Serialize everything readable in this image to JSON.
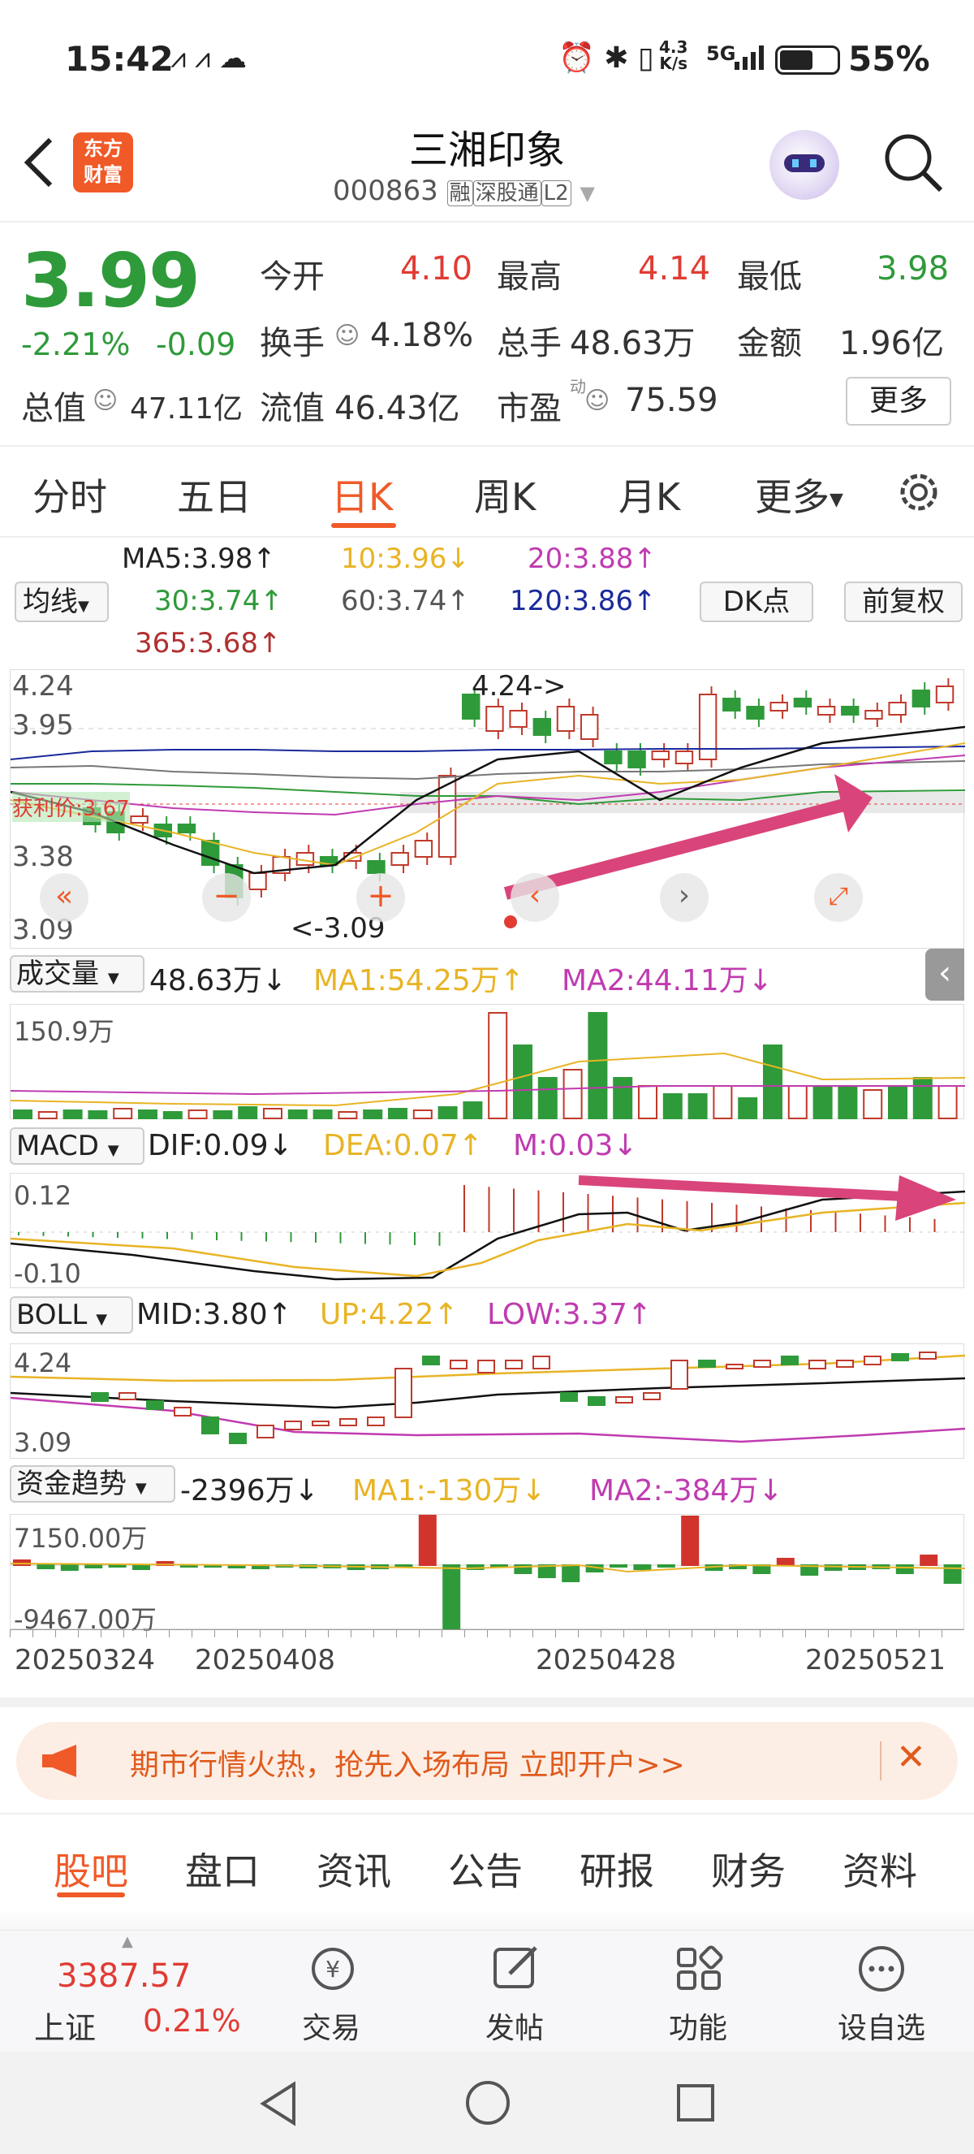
{
  "status_bar": {
    "time": "15:42",
    "net_speed_top": "4.3",
    "net_speed_bottom": "K/s",
    "network": "5G",
    "battery": "55%"
  },
  "header": {
    "app_logo_line1": "东方",
    "app_logo_line2": "财富",
    "title": "三湘印象",
    "code": "000863",
    "tags": [
      "融",
      "深股通",
      "L2"
    ]
  },
  "quote": {
    "price": "3.99",
    "change_pct": "-2.21%",
    "change": "-0.09",
    "open_label": "今开",
    "open": "4.10",
    "high_label": "最高",
    "high": "4.14",
    "low_label": "最低",
    "low": "3.98",
    "turnover_label": "换手",
    "turnover": "4.18%",
    "volume_label": "总手",
    "volume": "48.63万",
    "amount_label": "金额",
    "amount": "1.96亿",
    "mktcap_label": "总值",
    "mktcap": "47.11亿",
    "float_label": "流值",
    "float_cap": "46.43亿",
    "pe_label": "市盈",
    "pe_sup": "动",
    "pe": "75.59",
    "more": "更多"
  },
  "tabs": [
    "分时",
    "五日",
    "日K",
    "周K",
    "月K",
    "更多"
  ],
  "active_tab": "日K",
  "ma": {
    "selector": "均线",
    "ma5": "MA5:3.98↑",
    "ma10": "10:3.96↓",
    "ma20": "20:3.88↑",
    "ma30": "30:3.74↑",
    "ma60": "60:3.74↑",
    "ma120": "120:3.86↑",
    "ma365": "365:3.68↑",
    "dk": "DK点",
    "adjust": "前复权"
  },
  "kline": {
    "y_labels": [
      "4.24",
      "3.95",
      "3.38",
      "3.09"
    ],
    "max_mark": "4.24->",
    "min_mark": "<-3.09",
    "cost_label": "获利价:3.67"
  },
  "volume": {
    "selector": "成交量",
    "value": "48.63万↓",
    "ma1": "MA1:54.25万↑",
    "ma2": "MA2:44.11万↓",
    "y_label": "150.9万"
  },
  "macd": {
    "selector": "MACD",
    "dif": "DIF:0.09↓",
    "dea": "DEA:0.07↑",
    "m": "M:0.03↓",
    "y_top": "0.12",
    "y_bottom": "-0.10"
  },
  "boll": {
    "selector": "BOLL",
    "mid": "MID:3.80↑",
    "up": "UP:4.22↑",
    "low": "LOW:3.37↑",
    "y_top": "4.24",
    "y_bottom": "3.09"
  },
  "fund": {
    "selector": "资金趋势",
    "value": "-2396万↓",
    "ma1": "MA1:-130万↓",
    "ma2": "MA2:-384万↓",
    "y_top": "7150.00万",
    "y_bottom": "-9467.00万"
  },
  "dates": [
    "20250324",
    "20250408",
    "20250428",
    "20250521"
  ],
  "banner": {
    "text": "期市行情火热，抢先入场布局 立即开户>>"
  },
  "sub_tabs": [
    "股吧",
    "盘口",
    "资讯",
    "公告",
    "研报",
    "财务",
    "资料"
  ],
  "bottom_nav": {
    "index_value": "3387.57",
    "index_name": "上证",
    "index_change": "0.21%",
    "items": [
      "交易",
      "发帖",
      "功能",
      "设自选"
    ]
  },
  "colors": {
    "up": "#e03c34",
    "down": "#2f9a3a",
    "brand": "#f05a28"
  }
}
